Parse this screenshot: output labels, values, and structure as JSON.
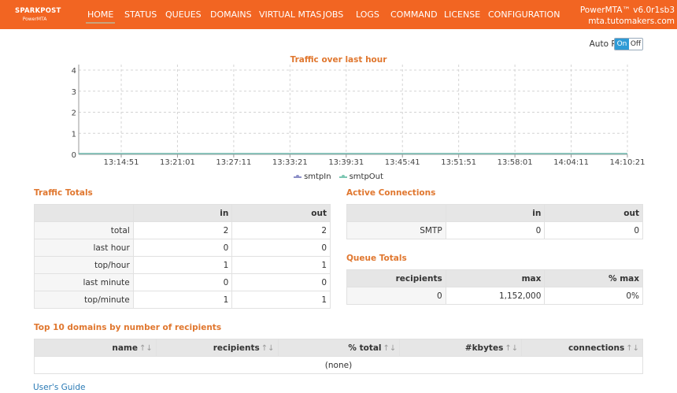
{
  "header": {
    "logo_brand": "SPARKPOST",
    "logo_sub": "PowerMTA",
    "version": "PowerMTA™ v6.0r1sb3",
    "hostname": "mta.tutomakers.com",
    "nav": [
      {
        "label": "HOME",
        "active": true
      },
      {
        "label": "STATUS",
        "active": false
      },
      {
        "label": "QUEUES",
        "active": false
      },
      {
        "label": "DOMAINS",
        "active": false
      },
      {
        "label": "VIRTUAL MTAS",
        "active": false
      },
      {
        "label": "JOBS",
        "active": false
      },
      {
        "label": "LOGS",
        "active": false
      },
      {
        "label": "COMMAND",
        "active": false
      },
      {
        "label": "LICENSE",
        "active": false
      },
      {
        "label": "CONFIGURATION",
        "active": false
      }
    ],
    "accent_color": "#f26522"
  },
  "auto_refresh": {
    "label": "Auto Refresh",
    "on_label": "On",
    "off_label": "Off",
    "state": "On"
  },
  "chart_data": {
    "type": "line",
    "title": "Traffic over last hour",
    "x": [
      "13:14:51",
      "13:21:01",
      "13:27:11",
      "13:33:21",
      "13:39:31",
      "13:45:41",
      "13:51:51",
      "13:58:01",
      "14:04:11",
      "14:10:21"
    ],
    "y_ticks": [
      0,
      1,
      2,
      3,
      4
    ],
    "ylim": [
      0,
      4
    ],
    "grid": true,
    "legend_position": "bottom",
    "series": [
      {
        "name": "smtpIn",
        "color": "#8c8fc7",
        "values": [
          0,
          0,
          0,
          0,
          0,
          0,
          0,
          0,
          0,
          0
        ]
      },
      {
        "name": "smtpOut",
        "color": "#7cc7b3",
        "values": [
          0,
          0,
          0,
          0,
          0,
          0,
          0,
          0,
          0,
          0
        ]
      }
    ]
  },
  "traffic_totals": {
    "title": "Traffic Totals",
    "columns": [
      "",
      "in",
      "out"
    ],
    "rows": [
      {
        "label": "total",
        "in": "2",
        "out": "2"
      },
      {
        "label": "last hour",
        "in": "0",
        "out": "0"
      },
      {
        "label": "top/hour",
        "in": "1",
        "out": "1"
      },
      {
        "label": "last minute",
        "in": "0",
        "out": "0"
      },
      {
        "label": "top/minute",
        "in": "1",
        "out": "1"
      }
    ]
  },
  "active_connections": {
    "title": "Active Connections",
    "columns": [
      "",
      "in",
      "out"
    ],
    "rows": [
      {
        "label": "SMTP",
        "in": "0",
        "out": "0"
      }
    ]
  },
  "queue_totals": {
    "title": "Queue Totals",
    "columns": [
      "recipients",
      "max",
      "% max"
    ],
    "rows": [
      {
        "recipients": "0",
        "max": "1,152,000",
        "pct_max": "0%"
      }
    ]
  },
  "top_domains": {
    "title": "Top 10 domains by number of recipients",
    "columns": [
      "name",
      "recipients",
      "% total",
      "#kbytes",
      "connections"
    ],
    "sort_icon": "↑↓",
    "empty_text": "(none)"
  },
  "footer": {
    "users_guide": "User's Guide"
  }
}
